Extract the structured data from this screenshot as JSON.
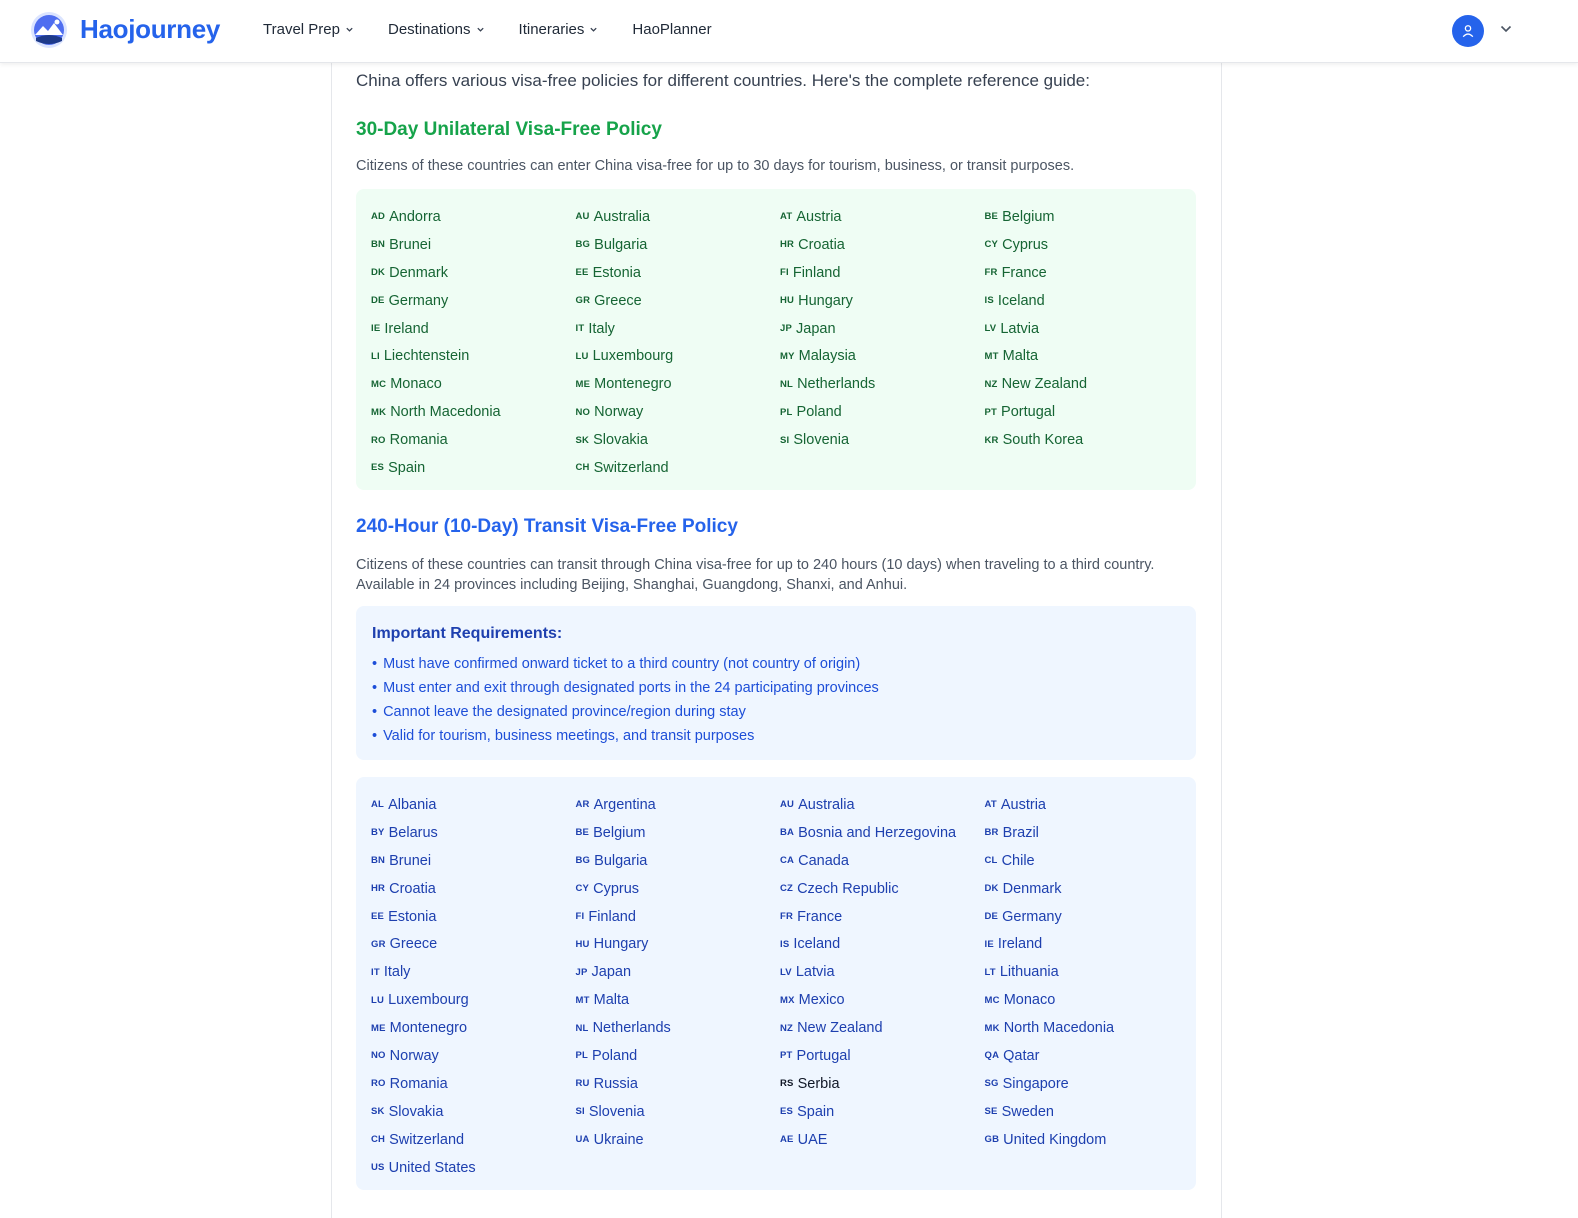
{
  "header": {
    "brand": "Haojourney",
    "nav": [
      {
        "label": "Travel Prep",
        "has_dropdown": true
      },
      {
        "label": "Destinations",
        "has_dropdown": true
      },
      {
        "label": "Itineraries",
        "has_dropdown": true
      },
      {
        "label": "HaoPlanner",
        "has_dropdown": false
      }
    ],
    "icons": {
      "logo": "mountain-logo-icon",
      "user": "user-icon",
      "user_menu": "chevron-down-icon"
    }
  },
  "colors": {
    "brand": "#2563eb",
    "green_heading": "#16a34a",
    "green_box": "#effdf4",
    "blue_box": "#eff6ff"
  },
  "content": {
    "intro": "China offers various visa-free policies for different countries. Here's the complete reference guide:",
    "policy30": {
      "title": "30-Day Unilateral Visa-Free Policy",
      "description": "Citizens of these countries can enter China visa-free for up to 30 days for tourism, business, or transit purposes.",
      "countries": [
        {
          "code": "AD",
          "name": "Andorra"
        },
        {
          "code": "AU",
          "name": "Australia"
        },
        {
          "code": "AT",
          "name": "Austria"
        },
        {
          "code": "BE",
          "name": "Belgium"
        },
        {
          "code": "BN",
          "name": "Brunei"
        },
        {
          "code": "BG",
          "name": "Bulgaria"
        },
        {
          "code": "HR",
          "name": "Croatia"
        },
        {
          "code": "CY",
          "name": "Cyprus"
        },
        {
          "code": "DK",
          "name": "Denmark"
        },
        {
          "code": "EE",
          "name": "Estonia"
        },
        {
          "code": "FI",
          "name": "Finland"
        },
        {
          "code": "FR",
          "name": "France"
        },
        {
          "code": "DE",
          "name": "Germany"
        },
        {
          "code": "GR",
          "name": "Greece"
        },
        {
          "code": "HU",
          "name": "Hungary"
        },
        {
          "code": "IS",
          "name": "Iceland"
        },
        {
          "code": "IE",
          "name": "Ireland"
        },
        {
          "code": "IT",
          "name": "Italy"
        },
        {
          "code": "JP",
          "name": "Japan"
        },
        {
          "code": "LV",
          "name": "Latvia"
        },
        {
          "code": "LI",
          "name": "Liechtenstein"
        },
        {
          "code": "LU",
          "name": "Luxembourg"
        },
        {
          "code": "MY",
          "name": "Malaysia"
        },
        {
          "code": "MT",
          "name": "Malta"
        },
        {
          "code": "MC",
          "name": "Monaco"
        },
        {
          "code": "ME",
          "name": "Montenegro"
        },
        {
          "code": "NL",
          "name": "Netherlands"
        },
        {
          "code": "NZ",
          "name": "New Zealand"
        },
        {
          "code": "MK",
          "name": "North Macedonia"
        },
        {
          "code": "NO",
          "name": "Norway"
        },
        {
          "code": "PL",
          "name": "Poland"
        },
        {
          "code": "PT",
          "name": "Portugal"
        },
        {
          "code": "RO",
          "name": "Romania"
        },
        {
          "code": "SK",
          "name": "Slovakia"
        },
        {
          "code": "SI",
          "name": "Slovenia"
        },
        {
          "code": "KR",
          "name": "South Korea"
        },
        {
          "code": "ES",
          "name": "Spain"
        },
        {
          "code": "CH",
          "name": "Switzerland"
        }
      ]
    },
    "policy240": {
      "title": "240-Hour (10-Day) Transit Visa-Free Policy",
      "description": "Citizens of these countries can transit through China visa-free for up to 240 hours (10 days) when traveling to a third country. Available in 24 provinces including Beijing, Shanghai, Guangdong, Shanxi, and Anhui.",
      "requirements_title": "Important Requirements:",
      "requirements": [
        "Must have confirmed onward ticket to a third country (not country of origin)",
        "Must enter and exit through designated ports in the 24 participating provinces",
        "Cannot leave the designated province/region during stay",
        "Valid for tourism, business meetings, and transit purposes"
      ],
      "countries": [
        {
          "code": "AL",
          "name": "Albania"
        },
        {
          "code": "AR",
          "name": "Argentina"
        },
        {
          "code": "AU",
          "name": "Australia"
        },
        {
          "code": "AT",
          "name": "Austria"
        },
        {
          "code": "BY",
          "name": "Belarus"
        },
        {
          "code": "BE",
          "name": "Belgium"
        },
        {
          "code": "BA",
          "name": "Bosnia and Herzegovina"
        },
        {
          "code": "BR",
          "name": "Brazil"
        },
        {
          "code": "BN",
          "name": "Brunei"
        },
        {
          "code": "BG",
          "name": "Bulgaria"
        },
        {
          "code": "CA",
          "name": "Canada"
        },
        {
          "code": "CL",
          "name": "Chile"
        },
        {
          "code": "HR",
          "name": "Croatia"
        },
        {
          "code": "CY",
          "name": "Cyprus"
        },
        {
          "code": "CZ",
          "name": "Czech Republic"
        },
        {
          "code": "DK",
          "name": "Denmark"
        },
        {
          "code": "EE",
          "name": "Estonia"
        },
        {
          "code": "FI",
          "name": "Finland"
        },
        {
          "code": "FR",
          "name": "France"
        },
        {
          "code": "DE",
          "name": "Germany"
        },
        {
          "code": "GR",
          "name": "Greece"
        },
        {
          "code": "HU",
          "name": "Hungary"
        },
        {
          "code": "IS",
          "name": "Iceland"
        },
        {
          "code": "IE",
          "name": "Ireland"
        },
        {
          "code": "IT",
          "name": "Italy"
        },
        {
          "code": "JP",
          "name": "Japan"
        },
        {
          "code": "LV",
          "name": "Latvia"
        },
        {
          "code": "LT",
          "name": "Lithuania"
        },
        {
          "code": "LU",
          "name": "Luxembourg"
        },
        {
          "code": "MT",
          "name": "Malta"
        },
        {
          "code": "MX",
          "name": "Mexico"
        },
        {
          "code": "MC",
          "name": "Monaco"
        },
        {
          "code": "ME",
          "name": "Montenegro"
        },
        {
          "code": "NL",
          "name": "Netherlands"
        },
        {
          "code": "NZ",
          "name": "New Zealand"
        },
        {
          "code": "MK",
          "name": "North Macedonia"
        },
        {
          "code": "NO",
          "name": "Norway"
        },
        {
          "code": "PL",
          "name": "Poland"
        },
        {
          "code": "PT",
          "name": "Portugal"
        },
        {
          "code": "QA",
          "name": "Qatar"
        },
        {
          "code": "RO",
          "name": "Romania"
        },
        {
          "code": "RU",
          "name": "Russia"
        },
        {
          "code": "RS",
          "name": "Serbia",
          "dark": true
        },
        {
          "code": "SG",
          "name": "Singapore"
        },
        {
          "code": "SK",
          "name": "Slovakia"
        },
        {
          "code": "SI",
          "name": "Slovenia"
        },
        {
          "code": "ES",
          "name": "Spain"
        },
        {
          "code": "SE",
          "name": "Sweden"
        },
        {
          "code": "CH",
          "name": "Switzerland"
        },
        {
          "code": "UA",
          "name": "Ukraine"
        },
        {
          "code": "AE",
          "name": "UAE"
        },
        {
          "code": "GB",
          "name": "United Kingdom"
        },
        {
          "code": "US",
          "name": "United States"
        }
      ]
    }
  }
}
